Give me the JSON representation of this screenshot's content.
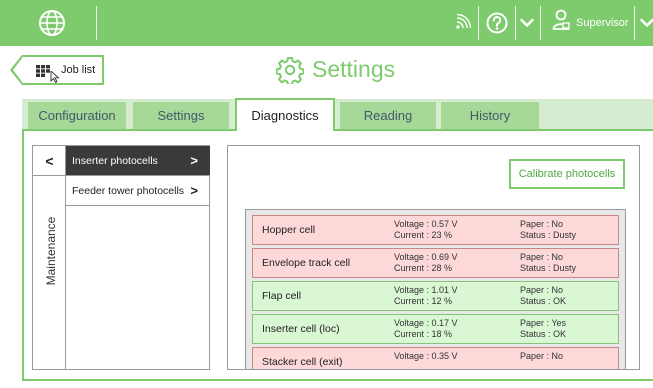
{
  "header": {
    "user": "Supervisor",
    "icons": [
      "globe-logo-icon",
      "signal-icon",
      "help-icon",
      "chevron-down-icon",
      "user-icon",
      "chevron-down-icon"
    ]
  },
  "subheader": {
    "job_list_label": "Job list",
    "title": "Settings"
  },
  "tabs": [
    {
      "label": "Configuration",
      "active": false
    },
    {
      "label": "Settings",
      "active": false
    },
    {
      "label": "Diagnostics",
      "active": true
    },
    {
      "label": "Reading",
      "active": false
    },
    {
      "label": "History",
      "active": false
    }
  ],
  "sidebar": {
    "back_label": "<",
    "section_label": "Maintenance",
    "items": [
      {
        "label": "Inserter photocells",
        "chevron": ">",
        "selected": true
      },
      {
        "label": "Feeder tower photocells",
        "chevron": ">",
        "selected": false
      }
    ]
  },
  "main": {
    "calibrate_label": "Calibrate photocells",
    "cells": [
      {
        "name": "Hopper cell",
        "voltage": "Voltage : 0.57 V",
        "current": "Current : 23 %",
        "paper": "Paper : No",
        "status": "Status : Dusty",
        "state": "error"
      },
      {
        "name": "Envelope track cell",
        "voltage": "Voltage : 0.69 V",
        "current": "Current : 28 %",
        "paper": "Paper : No",
        "status": "Status : Dusty",
        "state": "error"
      },
      {
        "name": "Flap cell",
        "voltage": "Voltage : 1.01 V",
        "current": "Current : 12 %",
        "paper": "Paper : No",
        "status": "Status : OK",
        "state": "ok"
      },
      {
        "name": "Inserter cell (loc)",
        "voltage": "Voltage : 0.17 V",
        "current": "Current : 18 %",
        "paper": "Paper : Yes",
        "status": "Status : OK",
        "state": "ok"
      },
      {
        "name": "Stacker cell (exit)",
        "voltage": "Voltage : 0.35 V",
        "current": "",
        "paper": "Paper : No",
        "status": "",
        "state": "error"
      }
    ]
  },
  "colors": {
    "accent_green": "#7ecb6e",
    "tab_inactive": "#a6d898",
    "error_bg": "#fcd8d8",
    "ok_bg": "#d9f7d3",
    "selected_dark": "#3a3a3a"
  }
}
